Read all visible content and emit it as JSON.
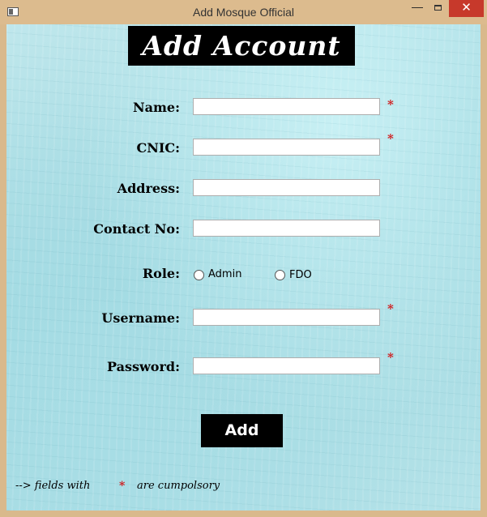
{
  "window": {
    "title": "Add Mosque Official",
    "minimize_glyph": "—",
    "close_glyph": "✕"
  },
  "form": {
    "heading": "Add Account",
    "fields": [
      {
        "label": "Name:",
        "value": "",
        "required": true
      },
      {
        "label": "CNIC:",
        "value": "",
        "required": true
      },
      {
        "label": "Address:",
        "value": "",
        "required": false
      },
      {
        "label": "Contact No:",
        "value": "",
        "required": false
      },
      {
        "label": "Username:",
        "value": "",
        "required": true
      },
      {
        "label": "Password:",
        "value": "",
        "required": true
      }
    ],
    "role": {
      "label": "Role:",
      "options": [
        "Admin",
        "FDO"
      ],
      "selected": ""
    },
    "required_marker": "*",
    "submit_label": "Add"
  },
  "footer": {
    "prefix": "--> fields with",
    "star": "*",
    "suffix": "are cumpolsory"
  },
  "colors": {
    "required": "#d0191a",
    "background": "#a9dde4",
    "button": "#000000"
  }
}
